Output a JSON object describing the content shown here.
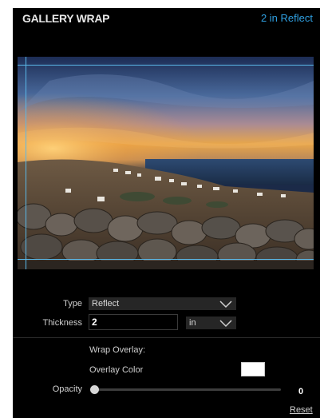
{
  "panel": {
    "title": "GALLERY WRAP",
    "summary": "2 in Reflect"
  },
  "controls": {
    "type": {
      "label": "Type",
      "value": "Reflect"
    },
    "thickness": {
      "label": "Thickness",
      "value": "2",
      "unit": "in"
    },
    "wrap_overlay_label": "Wrap Overlay:",
    "overlay_color": {
      "label": "Overlay Color",
      "color": "#ffffff"
    },
    "opacity": {
      "label": "Opacity",
      "value": "0",
      "fraction": 0.0
    },
    "reset_label": "Reset"
  },
  "colors": {
    "accent": "#2f9fe0",
    "guide": "#5ab8e8",
    "background": "#000000"
  }
}
